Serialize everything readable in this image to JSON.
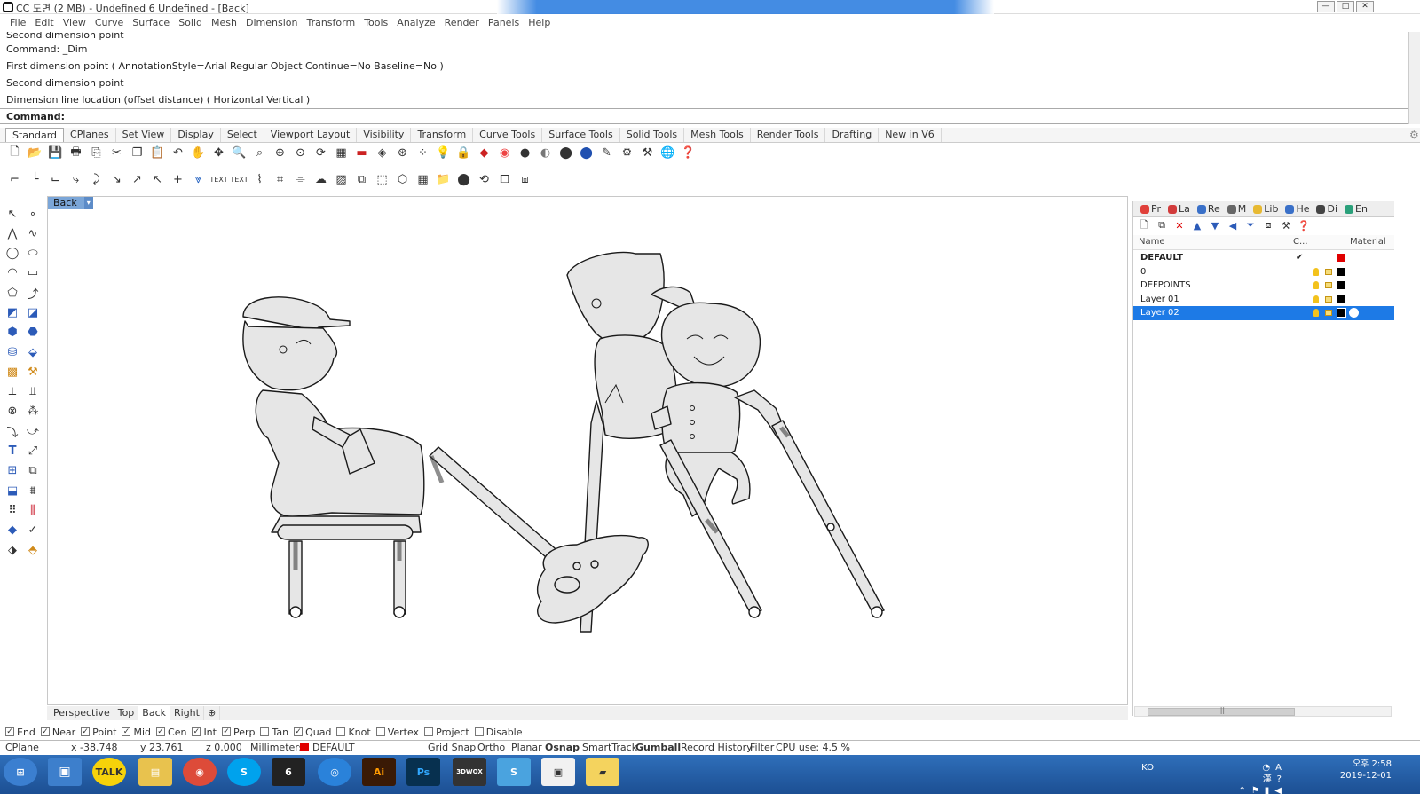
{
  "window": {
    "title": "CC 도면 (2 MB) - Undefined 6 Undefined - [Back]",
    "minimize": "—",
    "maximize": "□",
    "close": "✕"
  },
  "menu": [
    "File",
    "Edit",
    "View",
    "Curve",
    "Surface",
    "Solid",
    "Mesh",
    "Dimension",
    "Transform",
    "Tools",
    "Analyze",
    "Render",
    "Panels",
    "Help"
  ],
  "command_history": [
    "Second dimension point",
    "Command: _Dim",
    "First dimension point ( AnnotationStyle=Arial Regular  Object  Continue=No  Baseline=No )",
    "Second dimension point",
    "Dimension line location (offset distance) ( Horizontal  Vertical )"
  ],
  "command_prompt": "Command:",
  "toolbar_tabs": [
    "Standard",
    "CPlanes",
    "Set View",
    "Display",
    "Select",
    "Viewport Layout",
    "Visibility",
    "Transform",
    "Curve Tools",
    "Surface Tools",
    "Solid Tools",
    "Mesh Tools",
    "Render Tools",
    "Drafting",
    "New in V6"
  ],
  "viewport": {
    "name": "Back",
    "dropdown": "▾",
    "tabs": [
      "Perspective",
      "Top",
      "Back",
      "Right"
    ],
    "add_tab": "⊕"
  },
  "panel": {
    "tabs": [
      {
        "label": "Pr",
        "color": "#e0403a"
      },
      {
        "label": "La",
        "color": "#d23b3b"
      },
      {
        "label": "Re",
        "color": "#3a70c8"
      },
      {
        "label": "M",
        "color": "#666666"
      },
      {
        "label": "Lib",
        "color": "#e7b932"
      },
      {
        "label": "He",
        "color": "#3a70c8"
      },
      {
        "label": "Di",
        "color": "#444444"
      },
      {
        "label": "En",
        "color": "#2aa07a"
      }
    ],
    "columns": {
      "name": "Name",
      "current": "C...",
      "material": "Material"
    },
    "layers": [
      {
        "name": "DEFAULT",
        "current": "✔",
        "color": "#e00000",
        "bold": true
      },
      {
        "name": "0",
        "current": "",
        "color": "#000000"
      },
      {
        "name": "DEFPOINTS",
        "current": "",
        "color": "#000000"
      },
      {
        "name": "Layer 01",
        "current": "",
        "color": "#000000"
      },
      {
        "name": "Layer 02",
        "current": "",
        "color": "#000000",
        "selected": true
      }
    ],
    "scroll_grip": "|||"
  },
  "osnaps": [
    {
      "label": "End",
      "checked": true
    },
    {
      "label": "Near",
      "checked": true
    },
    {
      "label": "Point",
      "checked": true
    },
    {
      "label": "Mid",
      "checked": true
    },
    {
      "label": "Cen",
      "checked": true
    },
    {
      "label": "Int",
      "checked": true
    },
    {
      "label": "Perp",
      "checked": true
    },
    {
      "label": "Tan",
      "checked": false
    },
    {
      "label": "Quad",
      "checked": true
    },
    {
      "label": "Knot",
      "checked": false
    },
    {
      "label": "Vertex",
      "checked": false
    },
    {
      "label": "Project",
      "checked": false
    },
    {
      "label": "Disable",
      "checked": false
    }
  ],
  "status": {
    "cplane": "CPlane",
    "x": "x -38.748",
    "y": "y 23.761",
    "z": "z 0.000",
    "units": "Millimeters",
    "layer": "DEFAULT",
    "layer_color": "#e00000",
    "grid_snap": "Grid Snap",
    "ortho": "Ortho",
    "planar": "Planar",
    "osnap": "Osnap",
    "smarttrack": "SmartTrack",
    "gumball": "Gumball",
    "record_history": "Record History",
    "filter": "Filter",
    "cpu": "CPU use: 4.5 %"
  },
  "taskbar": {
    "apps": [
      {
        "label": "⊞",
        "color": "#3b7fd0"
      },
      {
        "label": "TALK",
        "color": "#f6d20a"
      },
      {
        "label": "▤",
        "color": "#e8c24e"
      },
      {
        "label": "◉",
        "color": "#dd4b39"
      },
      {
        "label": "S",
        "color": "#00a2ed"
      },
      {
        "label": "6",
        "color": "#222222"
      },
      {
        "label": "◎",
        "color": "#2a82da"
      },
      {
        "label": "Ai",
        "color": "#3a1a05"
      },
      {
        "label": "Ps",
        "color": "#07304f"
      },
      {
        "label": "3DWOX",
        "color": "#333333"
      },
      {
        "label": "S",
        "color": "#4aa3df"
      },
      {
        "label": "▣",
        "color": "#f1f1f1"
      },
      {
        "label": "▰",
        "color": "#f4d35e"
      }
    ],
    "ime": "KO",
    "time": "오후 2:58",
    "date": "2019-12-01"
  }
}
